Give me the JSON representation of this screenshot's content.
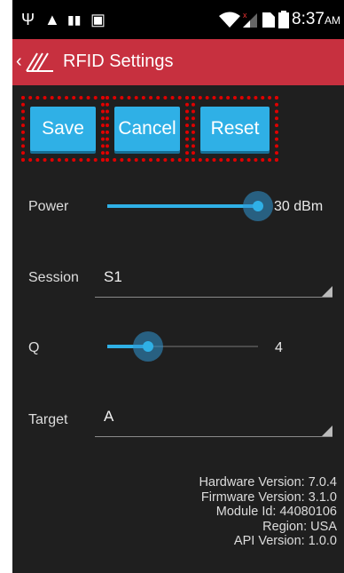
{
  "status_bar": {
    "icons": [
      "usb-icon",
      "warning-icon",
      "barcode-icon",
      "image-icon",
      "wifi-icon",
      "signal-icon",
      "sim-icon",
      "battery-icon"
    ],
    "time": "8:37",
    "ampm": "AM"
  },
  "app_bar": {
    "title": "RFID Settings",
    "accent_color": "#c7303f"
  },
  "toolbar": {
    "save_label": "Save",
    "cancel_label": "Cancel",
    "reset_label": "Reset",
    "button_color": "#2fb0e6"
  },
  "power": {
    "label": "Power",
    "value_text": "30 dBm",
    "level": 1.0
  },
  "session": {
    "label": "Session",
    "selected": "S1"
  },
  "q": {
    "label": "Q",
    "value_text": "4",
    "level": 0.27
  },
  "target": {
    "label": "Target",
    "selected": "A"
  },
  "info": {
    "hardware": "Hardware Version: 7.0.4",
    "firmware": "Firmware Version: 3.1.0",
    "module": "Module Id: 44080106",
    "region": "Region: USA",
    "api": "API Version: 1.0.0"
  }
}
